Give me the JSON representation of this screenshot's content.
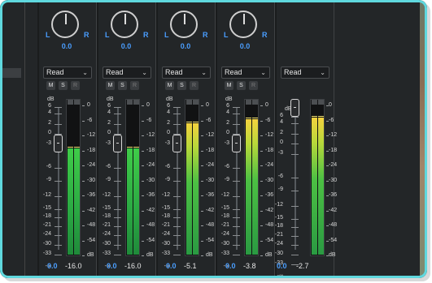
{
  "colors": {
    "accent": "#4a9eff",
    "meter_top": "#e8c93a",
    "meter_bottom": "#2fa54a",
    "frame": "#5fd8de"
  },
  "scale_labels": [
    "dB",
    "6",
    "4",
    "2",
    "0",
    "-3",
    "-6",
    "-9",
    "-12",
    "-15",
    "-18",
    "-21",
    "-24",
    "-30",
    "-33",
    "-∞"
  ],
  "meter_labels": [
    "0",
    "-6",
    "-12",
    "-18",
    "-24",
    "-30",
    "-36",
    "-42",
    "-48",
    "-54",
    "dB"
  ],
  "channels": [
    {
      "pan_l": "L",
      "pan_r": "R",
      "pan_value": "0.0",
      "automation": "Read",
      "m": "M",
      "s": "S",
      "r": "R",
      "volume": "0.0",
      "peak": "-16.0",
      "level_fraction": 0.72,
      "fader_db": 0.0
    },
    {
      "pan_l": "L",
      "pan_r": "R",
      "pan_value": "0.0",
      "automation": "Read",
      "m": "M",
      "s": "S",
      "r": "R",
      "volume": "0.0",
      "peak": "-16.0",
      "level_fraction": 0.72,
      "fader_db": 0.0
    },
    {
      "pan_l": "L",
      "pan_r": "R",
      "pan_value": "0.0",
      "automation": "Read",
      "m": "M",
      "s": "S",
      "r": "R",
      "volume": "0.0",
      "peak": "-5.1",
      "level_fraction": 0.89,
      "fader_db": 0.0
    },
    {
      "pan_l": "L",
      "pan_r": "R",
      "pan_value": "0.0",
      "automation": "Read",
      "m": "M",
      "s": "S",
      "r": "R",
      "volume": "0.0",
      "peak": "-3.8",
      "level_fraction": 0.92,
      "fader_db": 0.0
    },
    {
      "automation": "Read",
      "volume": "0.0",
      "peak": "-2.7",
      "level_fraction": 0.93,
      "fader_db": 0.0
    }
  ]
}
